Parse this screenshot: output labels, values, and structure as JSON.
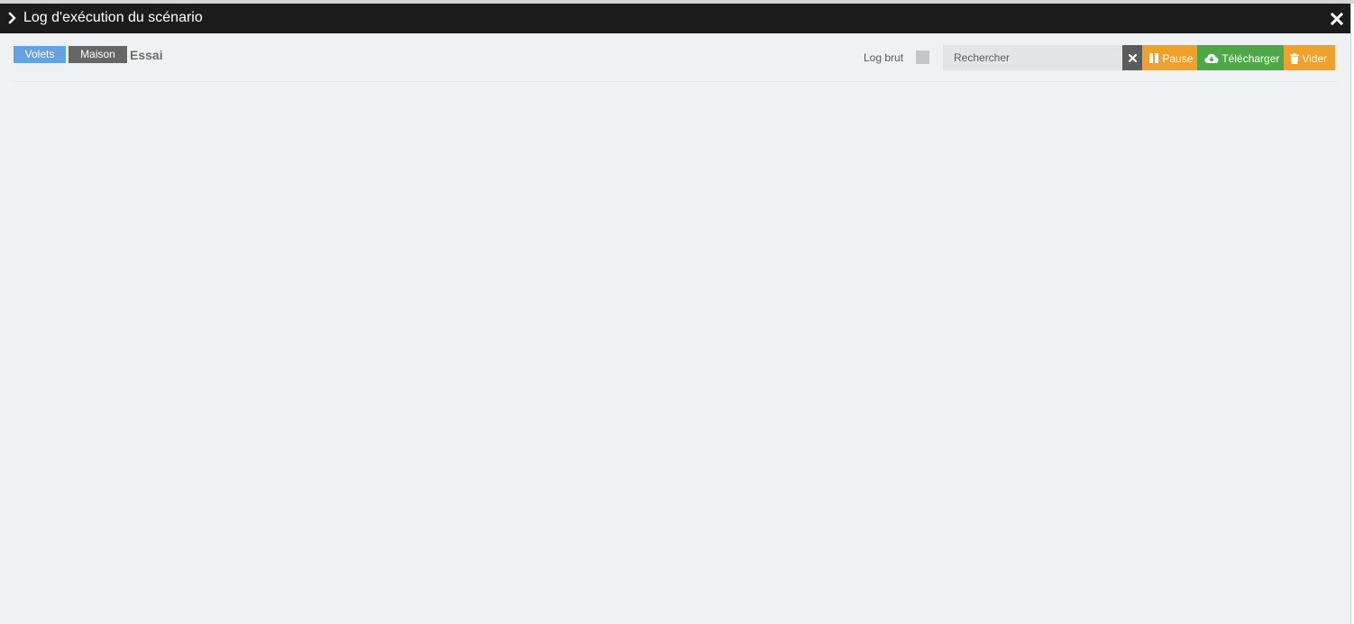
{
  "modal": {
    "title": "Log d'exécution du scénario",
    "icons": {
      "collapse": "chevron-right-icon",
      "close": "close-icon"
    }
  },
  "toolbar": {
    "tags": [
      {
        "label": "Volets",
        "color": "#65a2e2"
      },
      {
        "label": "Maison",
        "color": "#666666"
      }
    ],
    "scenario_name": "Essai",
    "raw_log_label": "Log brut",
    "raw_log_checked": false,
    "search": {
      "placeholder": "Rechercher",
      "value": ""
    },
    "pause_label": "Pause",
    "download_label": "Télécharger",
    "clear_label": "Vider"
  },
  "log": {
    "lines": []
  },
  "colors": {
    "titlebar": "#1c1c1c",
    "background": "#eff1f2",
    "orange": "#f0a02c",
    "green": "#4fa848",
    "dark_grey": "#5b5b5b"
  }
}
